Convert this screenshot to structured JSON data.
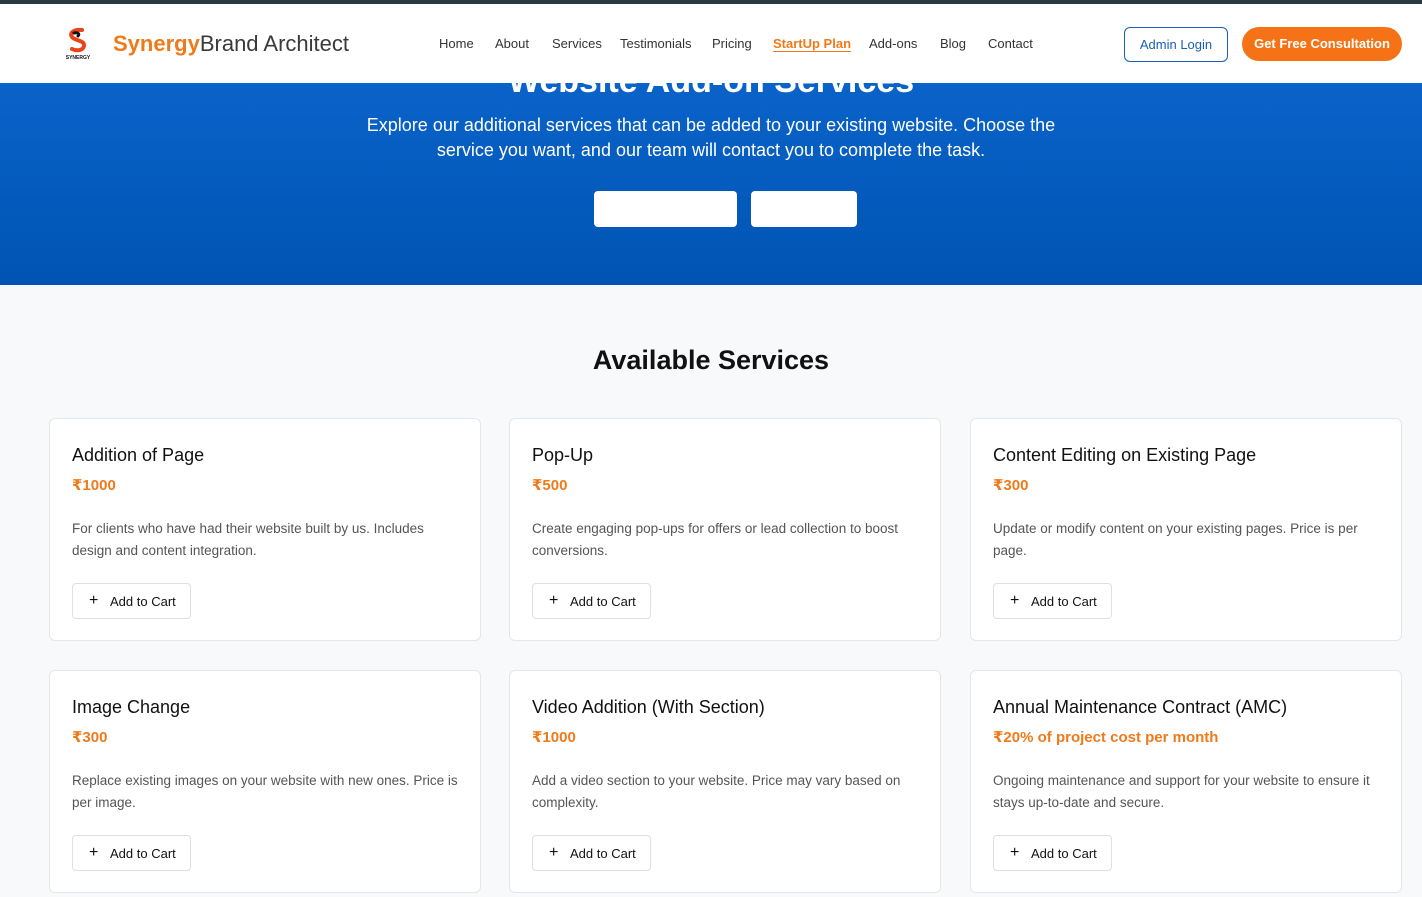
{
  "brand": {
    "logo_icon": "synergy-logo",
    "logo_caption": "SYNERGY",
    "name_part1": "Synergy",
    "name_part2": "Brand Architect"
  },
  "nav": {
    "items": [
      {
        "label": "Home"
      },
      {
        "label": "About"
      },
      {
        "label": "Services"
      },
      {
        "label": "Testimonials"
      },
      {
        "label": "Pricing"
      },
      {
        "label": "StartUp Plan",
        "active": true
      },
      {
        "label": "Add-ons"
      },
      {
        "label": "Blog"
      },
      {
        "label": "Contact"
      }
    ],
    "admin_login": "Admin Login",
    "consultation": "Get Free Consultation"
  },
  "hero": {
    "title": "Website Add-on Services",
    "subtitle": "Explore our additional services that can be added to your existing website. Choose the service you want, and our team will contact you to complete the task."
  },
  "section": {
    "title": "Available Services"
  },
  "services": [
    {
      "title": "Addition of Page",
      "price": "₹1000",
      "description": "For clients who have had their website built by us. Includes design and content integration.",
      "button": "Add to Cart"
    },
    {
      "title": "Pop-Up",
      "price": "₹500",
      "description": "Create engaging pop-ups for offers or lead collection to boost conversions.",
      "button": "Add to Cart"
    },
    {
      "title": "Content Editing on Existing Page",
      "price": "₹300",
      "description": "Update or modify content on your existing pages. Price is per page.",
      "button": "Add to Cart"
    },
    {
      "title": "Image Change",
      "price": "₹300",
      "description": "Replace existing images on your website with new ones. Price is per image.",
      "button": "Add to Cart"
    },
    {
      "title": "Video Addition (With Section)",
      "price": "₹1000",
      "description": "Add a video section to your website. Price may vary based on complexity.",
      "button": "Add to Cart"
    },
    {
      "title": "Annual Maintenance Contract (AMC)",
      "price": "₹20% of project cost per month",
      "description": "Ongoing maintenance and support for your website to ensure it stays up-to-date and secure.",
      "button": "Add to Cart"
    }
  ],
  "colors": {
    "accent": "#f07a1a",
    "primary": "#0a63c9",
    "admin_border": "#1a5fb4"
  }
}
